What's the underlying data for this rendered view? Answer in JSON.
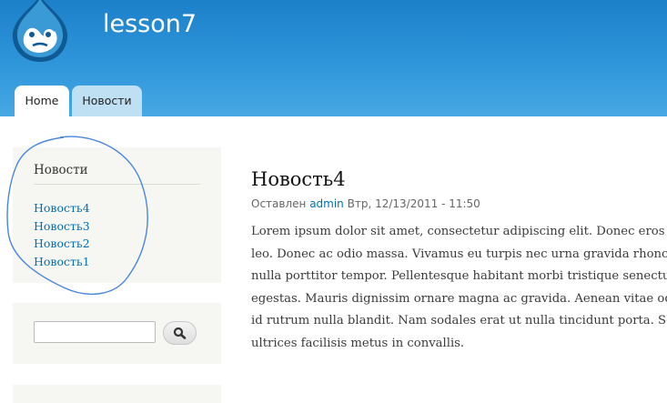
{
  "site": {
    "name": "lesson7"
  },
  "tabs": [
    {
      "label": "Home"
    },
    {
      "label": "Новости"
    }
  ],
  "sidebar": {
    "news_block": {
      "title": "Новости",
      "items": [
        "Новость4",
        "Новость3",
        "Новость2",
        "Новость1"
      ]
    },
    "search": {
      "value": "",
      "placeholder": "",
      "icon": "search-icon"
    }
  },
  "article": {
    "title": "Новость4",
    "submitted_prefix": "Оставлен",
    "author": "admin",
    "date": "Втр, 12/13/2011 - 11:50",
    "body_lines": [
      "Lorem ipsum dolor sit amet, consectetur adipiscing elit. Donec eros en",
      "leo. Donec ac odio massa. Vivamus eu turpis nec urna gravida rhoncu",
      "nulla porttitor tempor. Pellentesque habitant morbi tristique senectus",
      "egestas. Mauris dignissim ornare magna ac gravida. Aenean vitae odi",
      "id rutrum nulla blandit. Nam sodales erat ut nulla tincidunt porta. Se",
      "ultrices facilisis metus in convallis."
    ]
  },
  "colors": {
    "header_top": "#1c80c9",
    "header_bottom": "#47a8e4",
    "link": "#0071b3",
    "sidebar_bg": "#f6f6f2",
    "annotation": "#4a86e0"
  }
}
